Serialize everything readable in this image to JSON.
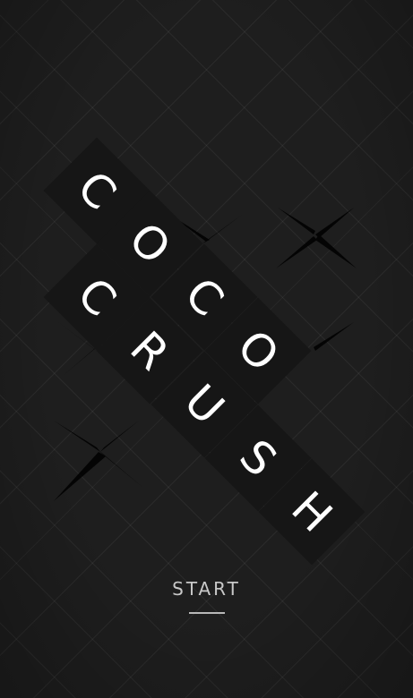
{
  "logo": {
    "words": [
      {
        "letters": [
          "C",
          "O",
          "C",
          "O"
        ]
      },
      {
        "letters": [
          "C",
          "C",
          "O",
          "H"
        ]
      },
      {
        "letters": [
          "C",
          "R",
          "U",
          "S",
          "H"
        ]
      }
    ],
    "tiles": [
      {
        "letter": "C"
      },
      {
        "letter": "O"
      },
      {
        "letter": "C"
      },
      {
        "letter": "O"
      },
      {
        "letter": "C"
      },
      {
        "letter": "R"
      },
      {
        "letter": "U"
      },
      {
        "letter": "S"
      },
      {
        "letter": "H"
      }
    ]
  },
  "start": {
    "label": "START"
  },
  "colors": {
    "background": "#1e1e1e",
    "tile": "#161616",
    "text": "#ffffff",
    "start_text": "#c8c8c8"
  }
}
